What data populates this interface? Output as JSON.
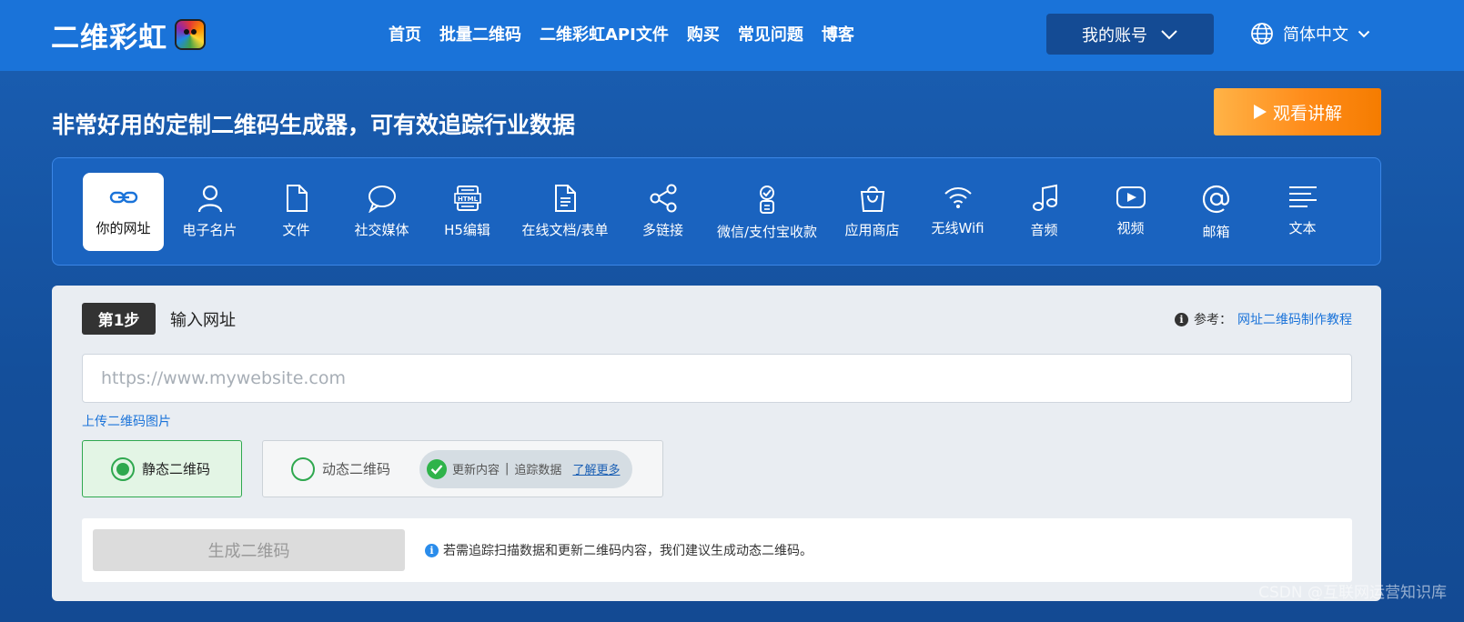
{
  "brand": {
    "name": "二维彩虹",
    "logo_icon": "rainbow-bear-icon"
  },
  "nav": [
    "首页",
    "批量二维码",
    "二维彩虹API文件",
    "购买",
    "常见问题",
    "博客"
  ],
  "account": {
    "label": "我的账号",
    "icon": "chevron-down-icon"
  },
  "language": {
    "label": "简体中文",
    "icon": "globe-icon"
  },
  "hero": {
    "headline": "非常好用的定制二维码生成器，可有效追踪行业数据",
    "watch_button": "观看讲解"
  },
  "categories": [
    {
      "label": "你的网址",
      "icon": "link-icon",
      "active": true
    },
    {
      "label": "电子名片",
      "icon": "person-icon"
    },
    {
      "label": "文件",
      "icon": "file-icon"
    },
    {
      "label": "社交媒体",
      "icon": "chat-bubble-icon"
    },
    {
      "label": "H5编辑",
      "icon": "html-icon"
    },
    {
      "label": "在线文档/表单",
      "icon": "document-icon"
    },
    {
      "label": "多链接",
      "icon": "share-icon"
    },
    {
      "label": "微信/支付宝收款",
      "icon": "payment-icon"
    },
    {
      "label": "应用商店",
      "icon": "shopping-bag-icon"
    },
    {
      "label": "无线Wifi",
      "icon": "wifi-icon"
    },
    {
      "label": "音频",
      "icon": "music-icon"
    },
    {
      "label": "视频",
      "icon": "video-icon"
    },
    {
      "label": "邮箱",
      "icon": "at-icon"
    },
    {
      "label": "文本",
      "icon": "text-icon"
    }
  ],
  "step": {
    "badge": "第1步",
    "title": "输入网址",
    "ref_label": "参考：",
    "ref_link": "网址二维码制作教程",
    "input_placeholder": "https://www.mywebsite.com",
    "upload_link": "上传二维码图片"
  },
  "qr_type": {
    "static_label": "静态二维码",
    "dynamic_label": "动态二维码",
    "selected": "static",
    "feature_update": "更新内容",
    "feature_separator": "|",
    "feature_track": "追踪数据",
    "learn_more": "了解更多"
  },
  "generate": {
    "button": "生成二维码",
    "tip": "若需追踪扫描数据和更新二维码内容，我们建议生成动态二维码。"
  },
  "watermark": "CSDN @互联网运营知识库",
  "colors": {
    "brand_blue": "#1a73d9",
    "orange": "#ff8c1a",
    "green": "#2fa84f"
  }
}
